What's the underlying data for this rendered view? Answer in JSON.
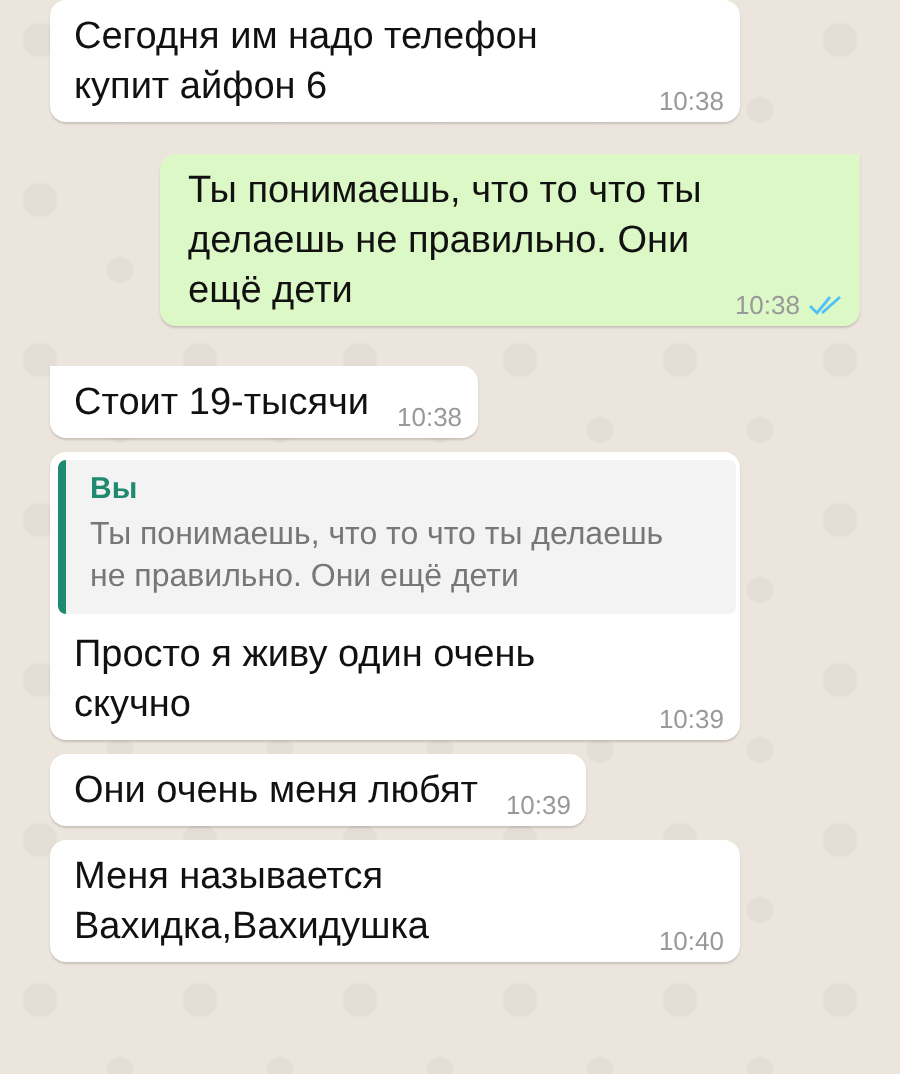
{
  "messages": [
    {
      "kind": "incoming",
      "text": "Сегодня им надо телефон купит айфон 6",
      "time": "10:38",
      "tail": false
    },
    {
      "kind": "outgoing",
      "text": "Ты понимаешь, что то что ты делаешь не правильно. Они ещё дети",
      "time": "10:38",
      "tail": true,
      "read": true
    },
    {
      "kind": "incoming",
      "text": "Стоит 19-тысячи",
      "time": "10:38",
      "tail": true
    },
    {
      "kind": "incoming",
      "quote": {
        "author": "Вы",
        "text": "Ты понимаешь, что то что ты делаешь не правильно. Они ещё дети"
      },
      "text": "Просто я живу один очень скучно",
      "time": "10:39",
      "tail": false
    },
    {
      "kind": "incoming",
      "text": "Они очень меня любят",
      "time": "10:39",
      "tail": false
    },
    {
      "kind": "incoming",
      "text": "Меня называется Вахидка,Вахидушка",
      "time": "10:40",
      "tail": false
    }
  ]
}
